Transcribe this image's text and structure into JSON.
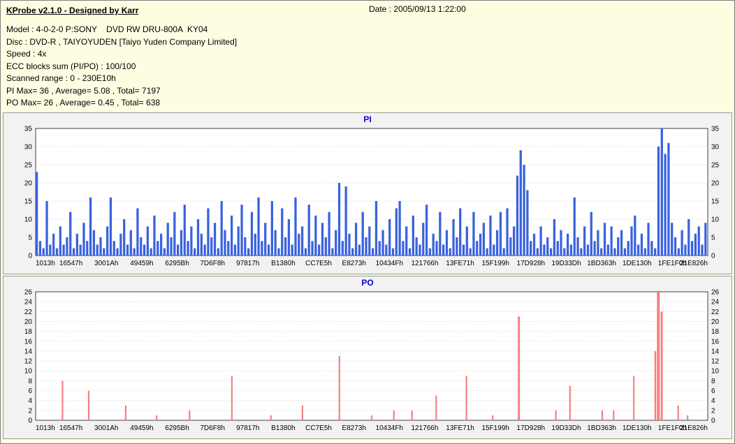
{
  "window": {
    "title": "KProbe v2.1.0 - Designed by Karr",
    "date_label": "Date : 2005/09/13 1:22:00"
  },
  "info": {
    "lines": [
      "Model : 4-0-2-0 P:SONY    DVD RW DRU-800A  KY04",
      "Disc : DVD-R , TAIYOYUDEN [Taiyo Yuden Company Limited]",
      "Speed : 4x",
      "ECC blocks sum (PI/PO) : 100/100",
      "Scanned range : 0 - 230E10h",
      "PI Max= 36 , Average= 5.08 , Total= 7197",
      "PO Max= 26 , Average= 0.45 , Total= 638"
    ]
  },
  "colors": {
    "header_bg": "#fdfde2",
    "panel_bg": "#f2f2f2",
    "title_blue": "#0000cc",
    "pi_bar": "#3a62dd",
    "po_bar": "#f4807f",
    "plot_bg": "#ffffff",
    "grid": "#d9d9d9",
    "frame": "#404040"
  },
  "chart_data": [
    {
      "type": "bar",
      "title": "PI",
      "ylabel": "",
      "xlabel": "",
      "ylim": [
        0,
        35
      ],
      "ytick_step": 5,
      "grid": "dotted",
      "legend": "none",
      "bar_color": "#3a62dd",
      "x_labels": [
        "1013h",
        "16547h",
        "3001Ah",
        "49459h",
        "6295Bh",
        "7D6F8h",
        "97817h",
        "B1380h",
        "CC7E5h",
        "E8273h",
        "10434Fh",
        "121766h",
        "13FE71h",
        "15F199h",
        "17D928h",
        "19D33Dh",
        "1BD363h",
        "1DE130h",
        "1FE1F0h",
        "21E826h"
      ],
      "notes": "dense PI error bars, max spike 35 near 1FE1F0h-21E826h, spike 29 near 19D33Dh",
      "values": [
        23,
        4,
        2,
        15,
        3,
        6,
        2,
        8,
        3,
        5,
        12,
        2,
        6,
        3,
        9,
        4,
        16,
        7,
        3,
        5,
        2,
        8,
        16,
        4,
        2,
        6,
        10,
        3,
        7,
        2,
        13,
        5,
        3,
        8,
        2,
        11,
        4,
        6,
        2,
        9,
        5,
        12,
        3,
        7,
        14,
        4,
        8,
        2,
        10,
        6,
        3,
        13,
        5,
        9,
        2,
        15,
        7,
        4,
        11,
        3,
        8,
        14,
        5,
        2,
        12,
        6,
        16,
        4,
        9,
        3,
        15,
        7,
        2,
        13,
        5,
        10,
        3,
        16,
        6,
        8,
        2,
        14,
        4,
        11,
        3,
        9,
        5,
        12,
        2,
        7,
        20,
        4,
        19,
        6,
        2,
        9,
        3,
        12,
        5,
        8,
        2,
        15,
        4,
        7,
        3,
        10,
        2,
        13,
        15,
        4,
        8,
        2,
        11,
        5,
        3,
        9,
        14,
        2,
        6,
        4,
        12,
        3,
        7,
        2,
        10,
        5,
        13,
        3,
        8,
        2,
        12,
        4,
        6,
        9,
        2,
        11,
        3,
        7,
        12,
        2,
        13,
        5,
        8,
        22,
        29,
        25,
        18,
        4,
        6,
        2,
        8,
        3,
        5,
        2,
        10,
        4,
        7,
        2,
        6,
        3,
        16,
        5,
        2,
        8,
        3,
        12,
        4,
        7,
        2,
        9,
        3,
        8,
        2,
        5,
        7,
        2,
        4,
        8,
        11,
        3,
        6,
        2,
        9,
        4,
        2,
        30,
        35,
        28,
        31,
        9,
        5,
        2,
        7,
        3,
        10,
        4,
        6,
        8,
        3,
        9
      ]
    },
    {
      "type": "bar",
      "title": "PO",
      "ylabel": "",
      "xlabel": "",
      "ylim": [
        0,
        26
      ],
      "ytick_step": 2,
      "grid": "dotted",
      "legend": "none",
      "bar_color": "#f4807f",
      "x_labels": [
        "1013h",
        "16547h",
        "3001Ah",
        "49459h",
        "6295Bh",
        "7D6F8h",
        "97817h",
        "B1380h",
        "CC7E5h",
        "E8273h",
        "10434Fh",
        "121766h",
        "13FE71h",
        "15F199h",
        "17D928h",
        "19D33Dh",
        "1BD363h",
        "1DE130h",
        "1FE1F0h",
        "21E826h"
      ],
      "notes": "sparse PO spikes on zero baseline; pos is fraction of x-range, h is value",
      "spikes": [
        {
          "pos": 0.04,
          "h": 8
        },
        {
          "pos": 0.079,
          "h": 6
        },
        {
          "pos": 0.134,
          "h": 3
        },
        {
          "pos": 0.18,
          "h": 1
        },
        {
          "pos": 0.229,
          "h": 2
        },
        {
          "pos": 0.292,
          "h": 9
        },
        {
          "pos": 0.35,
          "h": 1
        },
        {
          "pos": 0.397,
          "h": 3
        },
        {
          "pos": 0.452,
          "h": 13
        },
        {
          "pos": 0.5,
          "h": 1
        },
        {
          "pos": 0.533,
          "h": 2
        },
        {
          "pos": 0.56,
          "h": 2
        },
        {
          "pos": 0.596,
          "h": 5
        },
        {
          "pos": 0.641,
          "h": 9
        },
        {
          "pos": 0.68,
          "h": 1
        },
        {
          "pos": 0.719,
          "h": 21,
          "w": 3
        },
        {
          "pos": 0.774,
          "h": 2
        },
        {
          "pos": 0.795,
          "h": 7
        },
        {
          "pos": 0.843,
          "h": 2
        },
        {
          "pos": 0.86,
          "h": 2
        },
        {
          "pos": 0.89,
          "h": 9
        },
        {
          "pos": 0.922,
          "h": 14,
          "w": 2.5
        },
        {
          "pos": 0.9265,
          "h": 26,
          "w": 4
        },
        {
          "pos": 0.9315,
          "h": 22,
          "w": 3
        },
        {
          "pos": 0.956,
          "h": 3
        },
        {
          "pos": 0.97,
          "h": 1
        }
      ]
    }
  ]
}
